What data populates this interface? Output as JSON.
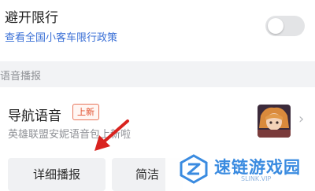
{
  "restriction": {
    "title": "避开限行",
    "link": "查看全国小客车限行政策",
    "toggle_state": "off"
  },
  "section": {
    "label": "语音播报"
  },
  "voice": {
    "title": "导航语音",
    "badge": "上新",
    "description": "英雄联盟安妮语音包上新啦",
    "chevron": "›"
  },
  "broadcast_mode": {
    "detailed": "详细播报",
    "brief": "简洁"
  },
  "watermark": {
    "text": "速链游戏园",
    "sub": "SLINK.VIP"
  },
  "colors": {
    "accent": "#3a6fd6",
    "badge": "#e2512f",
    "arrow": "#d9231f",
    "watermark": "#3a8be0"
  },
  "icons": {
    "toggle": "toggle-switch-icon",
    "chevron": "chevron-right-icon",
    "arrow": "red-pointer-arrow-icon",
    "logo": "watermark-logo-icon"
  }
}
